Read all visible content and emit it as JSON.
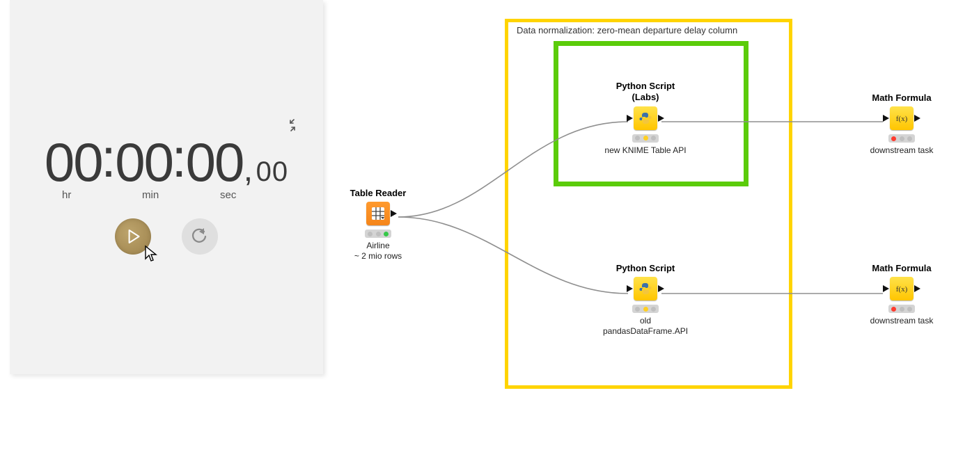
{
  "stopwatch": {
    "hours": "00",
    "minutes": "00",
    "seconds": "00",
    "centiseconds": "00",
    "sep1": ":",
    "sep2": ":",
    "sep3": ",",
    "label_hr": "hr",
    "label_min": "min",
    "label_sec": "sec"
  },
  "annotations": {
    "yellow_label": "Data normalization: zero-mean  departure delay  column"
  },
  "nodes": {
    "table_reader": {
      "title": "Table Reader",
      "caption_line1": "Airline",
      "caption_line2": "~ 2 mio rows"
    },
    "python_labs": {
      "title_line1": "Python Script",
      "title_line2": "(Labs)",
      "caption": "new KNIME Table API"
    },
    "python_old": {
      "title": "Python Script",
      "caption_line1": "old",
      "caption_line2": "pandasDataFrame.API"
    },
    "math_top": {
      "title": "Math Formula",
      "caption": "downstream task"
    },
    "math_bottom": {
      "title": "Math Formula",
      "caption": "downstream task"
    }
  }
}
